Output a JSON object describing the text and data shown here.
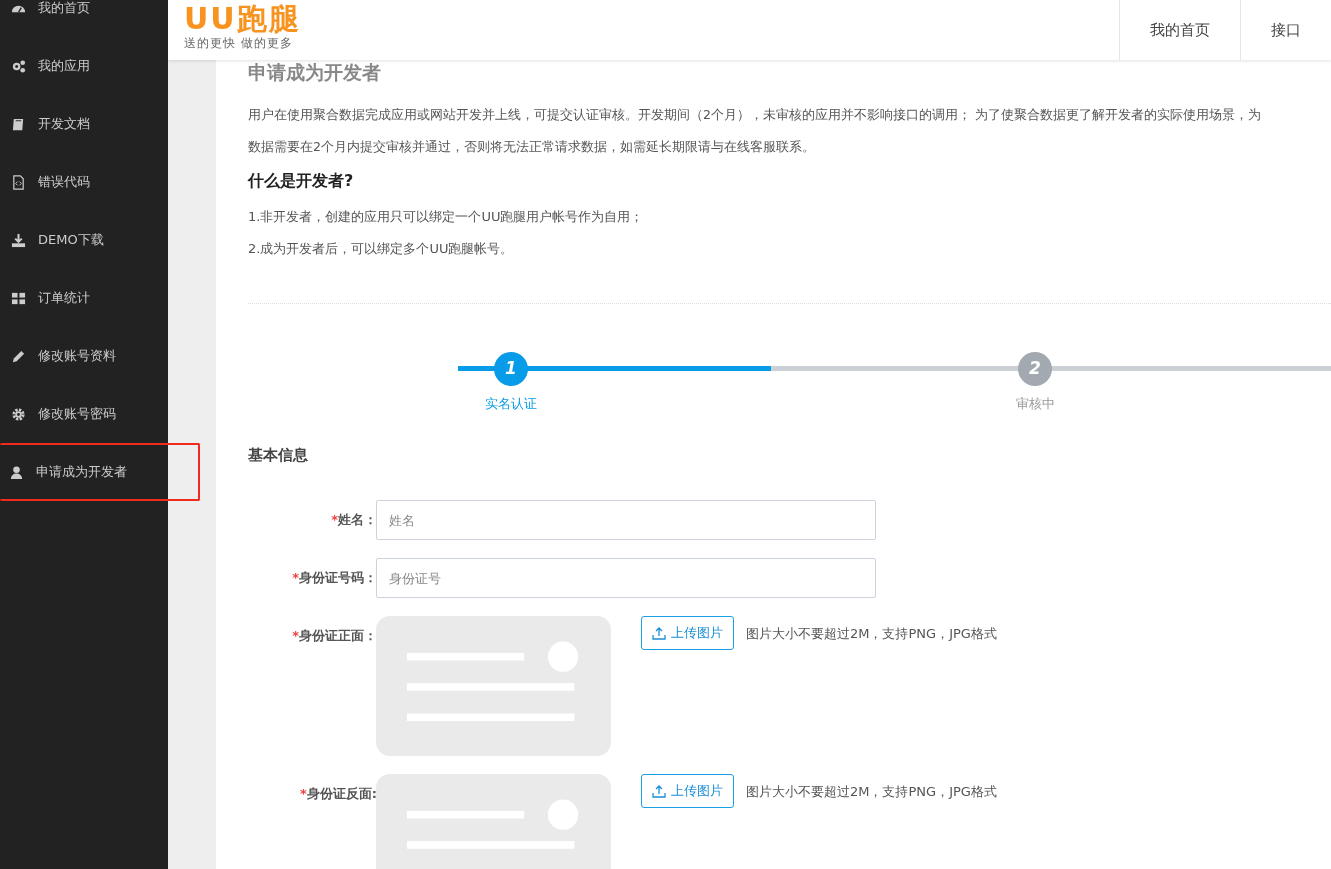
{
  "sidebar": {
    "items": [
      {
        "label": "我的首页",
        "kind": "dashboard",
        "highlighted": false
      },
      {
        "label": "我的应用",
        "kind": "gears",
        "highlighted": false
      },
      {
        "label": "开发文档",
        "kind": "book",
        "highlighted": false
      },
      {
        "label": "错误代码",
        "kind": "code",
        "highlighted": false
      },
      {
        "label": "DEMO下载",
        "kind": "download",
        "highlighted": false
      },
      {
        "label": "订单统计",
        "kind": "grid",
        "highlighted": false
      },
      {
        "label": "修改账号资料",
        "kind": "pencil",
        "highlighted": false
      },
      {
        "label": "修改账号密码",
        "kind": "gear",
        "highlighted": false
      },
      {
        "label": "申请成为开发者",
        "kind": "user",
        "highlighted": true
      }
    ]
  },
  "header": {
    "logo": "UU跑腿",
    "slogan": "送的更快 做的更多",
    "nav": [
      "我的首页",
      "接口"
    ]
  },
  "page": {
    "title": "申请成为开发者",
    "intro": [
      "用户在使用聚合数据完成应用或网站开发并上线，可提交认证审核。开发期间（2个月），未审核的应用并不影响接口的调用； 为了使聚合数据更了解开发者的实际使用场景，为",
      "数据需要在2个月内提交审核并通过，否则将无法正常请求数据，如需延长期限请与在线客服联系。"
    ],
    "what_title": "什么是开发者?",
    "what_items": [
      "1.非开发者，创建的应用只可以绑定一个UU跑腿用户帐号作为自用；",
      "2.成为开发者后，可以绑定多个UU跑腿帐号。"
    ]
  },
  "steps": [
    {
      "number": "1",
      "label": "实名认证",
      "selected": true
    },
    {
      "number": "2",
      "label": "审核中",
      "selected": false
    }
  ],
  "form": {
    "section_title": "基本信息",
    "fields": [
      {
        "kind": "text",
        "required_mark": "*",
        "label": "姓名：",
        "placeholder": "姓名"
      },
      {
        "kind": "text",
        "required_mark": "*",
        "label": "身份证号码：",
        "placeholder": "身份证号"
      },
      {
        "kind": "upload",
        "required_mark": "*",
        "label": "身份证正面：",
        "button": "上传图片",
        "hint": "图片大小不要超过2M，支持PNG，JPG格式"
      },
      {
        "kind": "upload",
        "required_mark": "*",
        "label": "身份证反面:",
        "button": "上传图片",
        "hint": "图片大小不要超过2M，支持PNG，JPG格式"
      }
    ]
  }
}
